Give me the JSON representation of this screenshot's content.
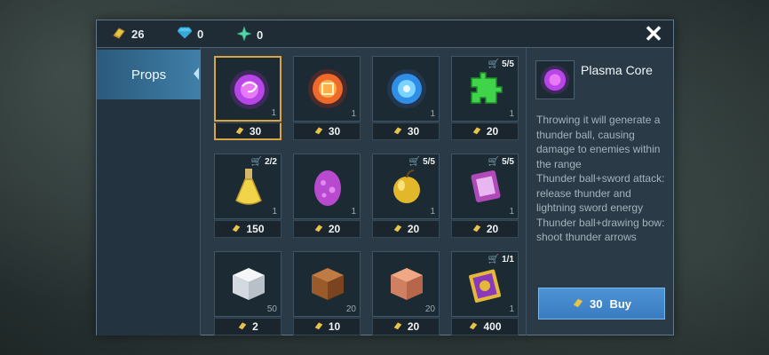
{
  "currency": {
    "gold": {
      "value": "26",
      "icon": "gold-bar-icon"
    },
    "diamond": {
      "value": "0",
      "icon": "diamond-icon"
    },
    "star": {
      "value": "0",
      "icon": "star-crystal-icon"
    }
  },
  "sidebar": {
    "tabs": [
      {
        "label": "Props",
        "active": true
      }
    ]
  },
  "items": [
    {
      "name": "Plasma Core",
      "icon": "plasma-core-icon",
      "price": "30",
      "qty": "1",
      "limit": "",
      "selected": true
    },
    {
      "name": "Fire Core",
      "icon": "fire-core-icon",
      "price": "30",
      "qty": "1",
      "limit": ""
    },
    {
      "name": "Ice Core",
      "icon": "ice-core-icon",
      "price": "30",
      "qty": "1",
      "limit": ""
    },
    {
      "name": "Green Puzzle",
      "icon": "puzzle-piece-icon",
      "price": "20",
      "qty": "1",
      "limit": "5/5"
    },
    {
      "name": "Potion",
      "icon": "potion-flask-icon",
      "price": "150",
      "qty": "1",
      "limit": "2/2"
    },
    {
      "name": "Egg",
      "icon": "egg-icon",
      "price": "20",
      "qty": "1",
      "limit": ""
    },
    {
      "name": "Golden Apple",
      "icon": "golden-apple-icon",
      "price": "20",
      "qty": "1",
      "limit": "5/5"
    },
    {
      "name": "Scroll",
      "icon": "scroll-icon",
      "price": "20",
      "qty": "1",
      "limit": "5/5"
    },
    {
      "name": "White Block",
      "icon": "white-block-icon",
      "price": "2",
      "qty": "50",
      "limit": ""
    },
    {
      "name": "Wood Block",
      "icon": "wood-block-icon",
      "price": "10",
      "qty": "20",
      "limit": ""
    },
    {
      "name": "Copper Block",
      "icon": "copper-block-icon",
      "price": "20",
      "qty": "20",
      "limit": ""
    },
    {
      "name": "Spell Book",
      "icon": "spell-book-icon",
      "price": "400",
      "qty": "1",
      "limit": "1/1"
    }
  ],
  "detail": {
    "name": "Plasma Core",
    "icon": "plasma-core-icon",
    "description": "Throwing it will generate a thunder ball, causing damage to enemies within the range\nThunder ball+sword attack: release thunder and lightning sword energy\nThunder ball+drawing bow: shoot thunder arrows",
    "buy_price": "30",
    "buy_label": "Buy"
  },
  "colors": {
    "accent": "#3a7bc0",
    "selected_border": "#d9a544",
    "panel": "#2a3a46"
  }
}
